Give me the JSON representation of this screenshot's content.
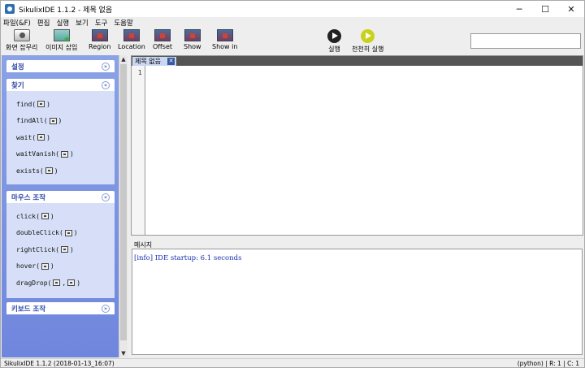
{
  "window": {
    "title": "SikulixIDE 1.1.2 - 제목 없음",
    "minimize": "─",
    "maximize": "☐",
    "close": "✕"
  },
  "menu": [
    "파일(&F)",
    "편집",
    "실행",
    "보기",
    "도구",
    "도움말"
  ],
  "toolbar": {
    "capture": "화면 잡무리",
    "insert_image": "이미지 삽입",
    "region": "Region",
    "location": "Location",
    "offset": "Offset",
    "show": "Show",
    "show_in": "Show in",
    "run": "실행",
    "run_slow": "천천히 실행",
    "search_value": ""
  },
  "sidebar": {
    "settings": {
      "title": "설정",
      "chevron": "»"
    },
    "find": {
      "title": "찾기",
      "chevron": "«",
      "items": [
        {
          "pre": "find(",
          "post": ")"
        },
        {
          "pre": "findAll(",
          "post": ")"
        },
        {
          "pre": "wait(",
          "post": ")"
        },
        {
          "pre": "waitVanish(",
          "post": ")"
        },
        {
          "pre": "exists(",
          "post": ")"
        }
      ]
    },
    "mouse": {
      "title": "마우스 조작",
      "chevron": "«",
      "items": [
        {
          "pre": "click(",
          "post": ")"
        },
        {
          "pre": "doubleClick(",
          "post": ")"
        },
        {
          "pre": "rightClick(",
          "post": ")"
        },
        {
          "pre": "hover(",
          "post": ")"
        },
        {
          "pre": "dragDrop(",
          "mid": ",",
          "post": ")"
        }
      ]
    },
    "keyboard": {
      "title": "키보드 조작",
      "chevron": "»"
    }
  },
  "editor": {
    "tab_label": "제목 없음",
    "tab_close": "✕",
    "line": "1"
  },
  "messages": {
    "label": "메시지",
    "lines": [
      "[info] IDE startup: 6.1 seconds"
    ]
  },
  "status": {
    "left": "SikulixIDE 1.1.2 (2018-01-13_16:07)",
    "right": "(python) | R: 1 | C: 1"
  }
}
